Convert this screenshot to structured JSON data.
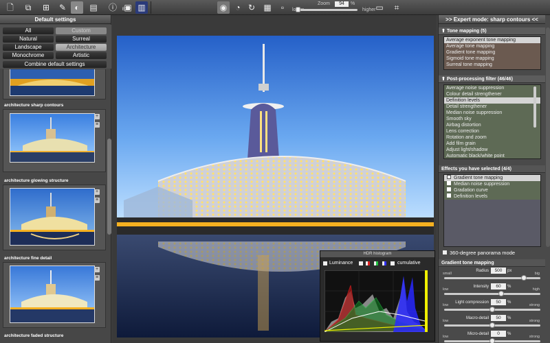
{
  "toolbar": {
    "zoom_label": "Zoom",
    "zoom_value": "94",
    "zoom_unit": "%",
    "lower": "lower",
    "higher": "higher",
    "exif": "EXIF"
  },
  "left": {
    "title": "Default settings",
    "presets": [
      {
        "label": "All",
        "state": "normal"
      },
      {
        "label": "Custom",
        "state": "disabled"
      },
      {
        "label": "Natural",
        "state": "normal"
      },
      {
        "label": "Surreal",
        "state": "normal"
      },
      {
        "label": "Landscape",
        "state": "normal"
      },
      {
        "label": "Architecture",
        "state": "selected"
      },
      {
        "label": "Monochrome",
        "state": "normal"
      },
      {
        "label": "Artistic",
        "state": "normal"
      }
    ],
    "combine": "Combine default settings",
    "thumbs": [
      "architecture sharp contours",
      "architecture glowing structure",
      "architecture fine detail",
      "architecture faded structure"
    ]
  },
  "right": {
    "title": ">> Expert mode: sharp contours <<",
    "tone_title": "Tone mapping (5)",
    "tone_items": [
      "Average exponent tone mapping",
      "Average tone mapping",
      "Gradient tone mapping",
      "Sigmoid tone mapping",
      "Surreal tone mapping"
    ],
    "post_title": "Post-processing filter (46/46)",
    "post_items": [
      "Average noise suppression",
      "Colour detail strengthener",
      "Definition levels",
      "Detail strengthener",
      "Median noise suppression",
      "Smooth sky",
      "Airbag distortion",
      "Lens correction",
      "Rotation and zoom",
      "Add film grain",
      "Adjust light/shadow",
      "Automatic black/white point"
    ],
    "effects_title": "Effects you have selected (4/4)",
    "effects_items": [
      "Gradient tone mapping",
      "Median noise suppression",
      "Gradation curve",
      "Definition levels"
    ],
    "panorama": "360-degree panorama mode",
    "gtm_title": "Gradient tone mapping",
    "sliders": [
      {
        "label": "Radius",
        "value": "500",
        "unit": "px",
        "low": "small",
        "high": "big",
        "pos": 0.85
      },
      {
        "label": "Intensity",
        "value": "60",
        "unit": "%",
        "low": "low",
        "high": "high",
        "pos": 0.6
      },
      {
        "label": "Light compression",
        "value": "50",
        "unit": "%",
        "low": "low",
        "high": "strong",
        "pos": 0.5
      },
      {
        "label": "Macro-detail",
        "value": "50",
        "unit": "%",
        "low": "low",
        "high": "strong",
        "pos": 0.5
      },
      {
        "label": "Micro-detail",
        "value": "0",
        "unit": "%",
        "low": "low",
        "high": "strong",
        "pos": 0.5
      }
    ]
  },
  "histogram": {
    "title": "HDR histogram",
    "luminance": "Luminance",
    "cumulative": "cumulative",
    "colors": {
      "red": "#e02020",
      "green": "#20c040",
      "blue": "#3030ff",
      "white": "#ffffff",
      "yellow": "#f0f000"
    }
  },
  "colors": {
    "selected_row": "#d5d5d5",
    "tone_list_bg": "#6b5a50",
    "post_list_bg": "#5e6a55",
    "effects_bg": "#5a5a66"
  }
}
